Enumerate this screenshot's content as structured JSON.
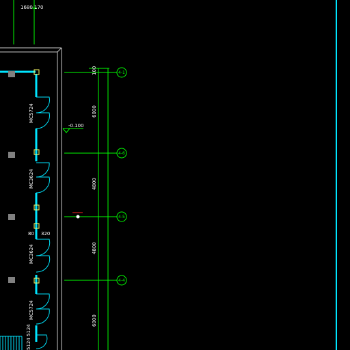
{
  "drawing": {
    "top_dimension": "1680 170",
    "elevation_label": "-0.100",
    "wall_offsets": {
      "left": "80",
      "right": "320"
    },
    "door_labels": [
      "MC5724",
      "MC3624",
      "MC3624",
      "MC5724"
    ],
    "stair_label": "5124 5124",
    "vertical_dimensions": [
      "100",
      "6000",
      "4800",
      "4800",
      "6000"
    ],
    "axis_bubbles": [
      "4-1",
      "4-6",
      "4-5",
      "4-4"
    ],
    "colors": {
      "background": "#000000",
      "wall": "#00e5ff",
      "axis": "#00ff00",
      "dimension_text": "#ffffff",
      "column": "#ffff66",
      "fixture": "#808080",
      "frame": "#c8c8c8",
      "marker": "#ff2020"
    }
  }
}
